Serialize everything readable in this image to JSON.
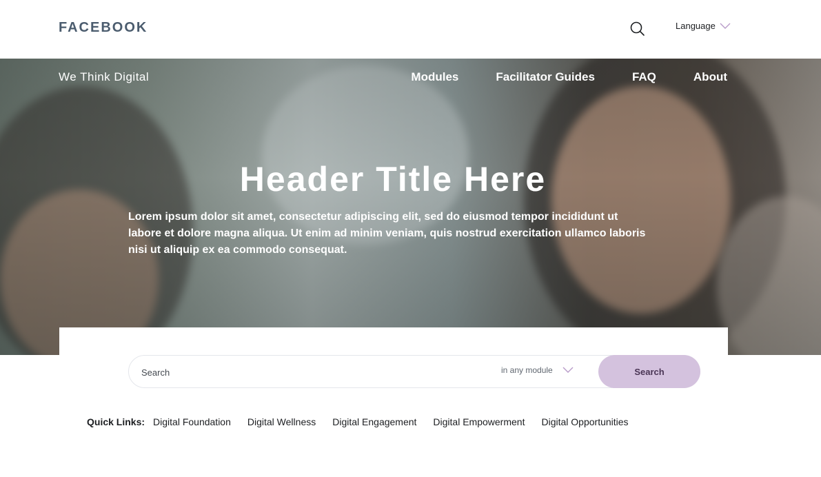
{
  "header": {
    "brand": "FACEBOOK",
    "language_label": "Language"
  },
  "hero": {
    "site_name": "We Think Digital",
    "nav": [
      "Modules",
      "Facilitator Guides",
      "FAQ",
      "About"
    ],
    "title": "Header Title Here",
    "body": "Lorem ipsum dolor sit amet, consectetur adipiscing elit, sed do eiusmod tempor incididunt ut labore et dolore magna aliqua. Ut enim ad minim veniam, quis nostrud exercitation ullamco laboris nisi ut aliquip ex ea commodo consequat."
  },
  "search": {
    "placeholder": "Search",
    "scope_label": "in any module",
    "button_label": "Search"
  },
  "quick_links": {
    "label": "Quick Links:",
    "items": [
      "Digital Foundation",
      "Digital Wellness",
      "Digital Engagement",
      "Digital Empowerment",
      "Digital Opportunities"
    ]
  },
  "colors": {
    "brand": "#4b5c6e",
    "accent": "#d4c2de",
    "accent_text": "#4a3555",
    "chevron": "#b89bc9"
  }
}
